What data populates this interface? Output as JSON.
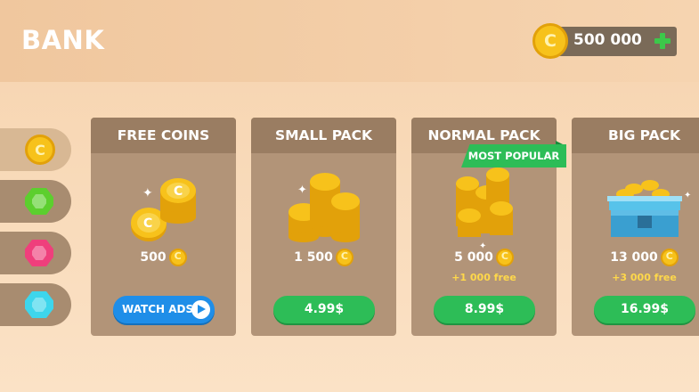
{
  "header": {
    "title": "BANK",
    "balance": "500 000",
    "balance_icon": "coin-icon",
    "add_icon": "plus-icon"
  },
  "sidebar": {
    "tabs": [
      {
        "icon": "coin-icon",
        "active": true
      },
      {
        "icon": "green-gem-icon",
        "active": false
      },
      {
        "icon": "pink-gem-icon",
        "active": false
      },
      {
        "icon": "cyan-gem-icon",
        "active": false
      }
    ]
  },
  "packs": [
    {
      "title": "FREE COINS",
      "amount": "500",
      "bonus": "",
      "button": "WATCH ADS"
    },
    {
      "title": "SMALL PACK",
      "amount": "1 500",
      "bonus": "",
      "button": "4.99$"
    },
    {
      "title": "NORMAL PACK",
      "amount": "5 000",
      "bonus": "+1 000 free",
      "button": "8.99$",
      "badge": "MOST POPULAR"
    },
    {
      "title": "BIG PACK",
      "amount": "13 000",
      "bonus": "+3 000 free",
      "button": "16.99$"
    }
  ],
  "colors": {
    "accent_green": "#2dbd57",
    "accent_blue": "#1f8ee8",
    "coin_gold": "#f7c21b",
    "card_bg": "#b29478"
  }
}
